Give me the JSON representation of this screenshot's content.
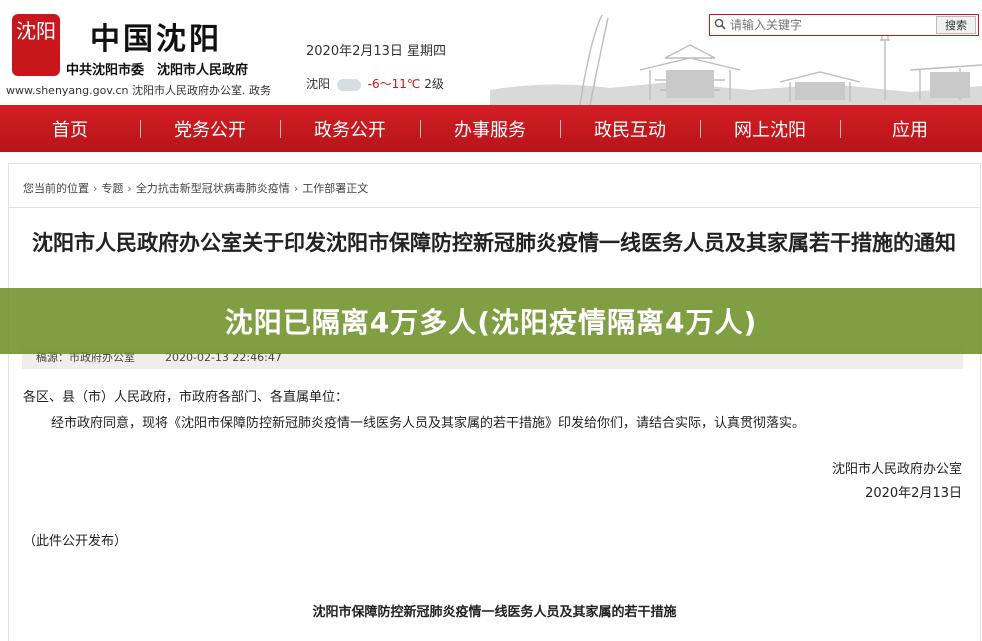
{
  "header": {
    "seal_text": "沈阳",
    "brand": "中国沈阳",
    "subbrand": "中共沈阳市委　沈阳市人民政府",
    "site_url": "www.shenyang.gov.cn 沈阳市人民政府办公室. 政务",
    "date": "2020年2月13日  星期四",
    "weather_city": "沈阳",
    "weather_temp": "-6～11℃",
    "weather_wind": "2级",
    "search_placeholder": "请输入关键字",
    "search_button": "搜索"
  },
  "nav": {
    "items": [
      "首页",
      "党务公开",
      "政务公开",
      "办事服务",
      "政民互动",
      "网上沈阳",
      "应用"
    ]
  },
  "breadcrumb": {
    "items": [
      "您当前的位置",
      "专题",
      "全力抗击新型冠状病毒肺炎疫情",
      "工作部署正文"
    ]
  },
  "article": {
    "title": "沈阳市人民政府办公室关于印发沈阳市保障防控新冠肺炎疫情一线医务人员及其家属若干措施的通知",
    "source_label": "稿源：",
    "source": "市政府办公室",
    "timestamp": "2020-02-13 22:46:47",
    "salutation": "各区、县（市）人民政府，市政府各部门、各直属单位：",
    "body": "经市政府同意，现将《沈阳市保障防控新冠肺炎疫情一线医务人员及其家属的若干措施》印发给你们，请结合实际，认真贯彻落实。",
    "sign_org": "沈阳市人民政府办公室",
    "sign_date": "2020年2月13日",
    "publish_note": "（此件公开发布）",
    "attachment_title": "沈阳市保障防控新冠肺炎疫情一线医务人员及其家属的若干措施"
  },
  "banner": {
    "text": "沈阳已隔离4万多人(沈阳疫情隔离4万人)"
  },
  "colors": {
    "brand_red": "#c8161d",
    "banner_green": "#6b8e23"
  }
}
